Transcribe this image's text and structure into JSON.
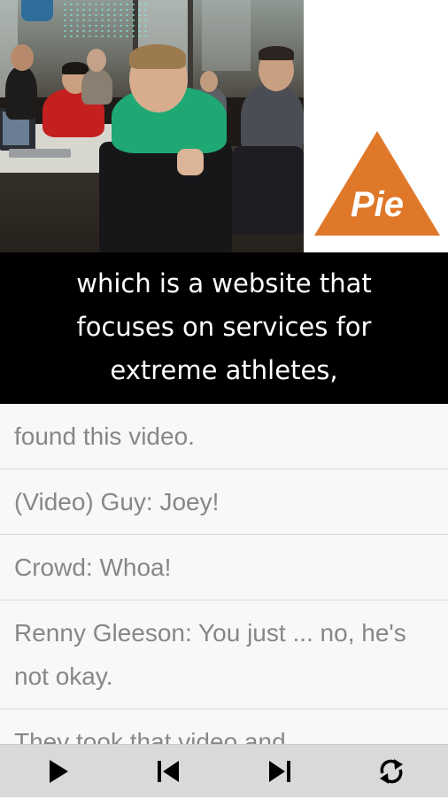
{
  "video": {
    "logo_text": "Pie",
    "logo_color": "#e0782a"
  },
  "caption": {
    "text": "which is a website that focuses on services for extreme athletes,"
  },
  "transcript": {
    "lines": [
      "found this video.",
      "(Video) Guy: Joey!",
      "Crowd: Whoa!",
      "Renny Gleeson: You just ... no, he's not okay.",
      "They took that video and"
    ]
  },
  "controls": {
    "icons": [
      "play-icon",
      "skip-previous-icon",
      "skip-next-icon",
      "repeat-icon"
    ]
  }
}
